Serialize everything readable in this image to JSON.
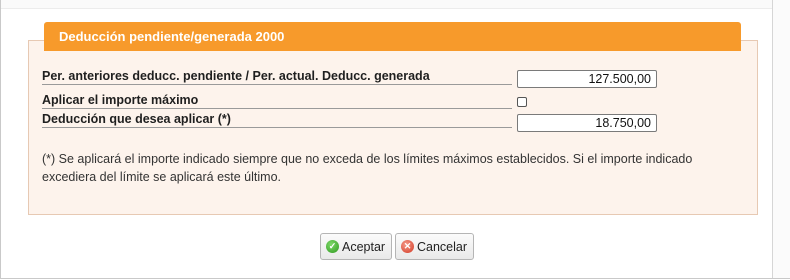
{
  "panel": {
    "title": "Deducción pendiente/generada 2000"
  },
  "fields": {
    "anteriores": {
      "label": "Per. anteriores deducc. pendiente / Per. actual. Deducc. generada",
      "value": "127.500,00"
    },
    "aplicar_maximo": {
      "label": "Aplicar el importe máximo",
      "checked": false
    },
    "deduccion": {
      "label": "Deducción que desea aplicar (*)",
      "value": "18.750,00"
    }
  },
  "note": "(*) Se aplicará el importe indicado siempre que no exceda de los límites máximos establecidos. Si el importe indicado excediera del límite se aplicará este último.",
  "buttons": {
    "accept": "Aceptar",
    "cancel": "Cancelar"
  },
  "colors": {
    "header_bg": "#f79a2b",
    "panel_bg": "#fdf3ec",
    "accept_icon": "#2f9a1f",
    "cancel_icon": "#d23a24"
  },
  "icons": {
    "accept": "check-circle-icon",
    "cancel": "x-circle-icon"
  }
}
